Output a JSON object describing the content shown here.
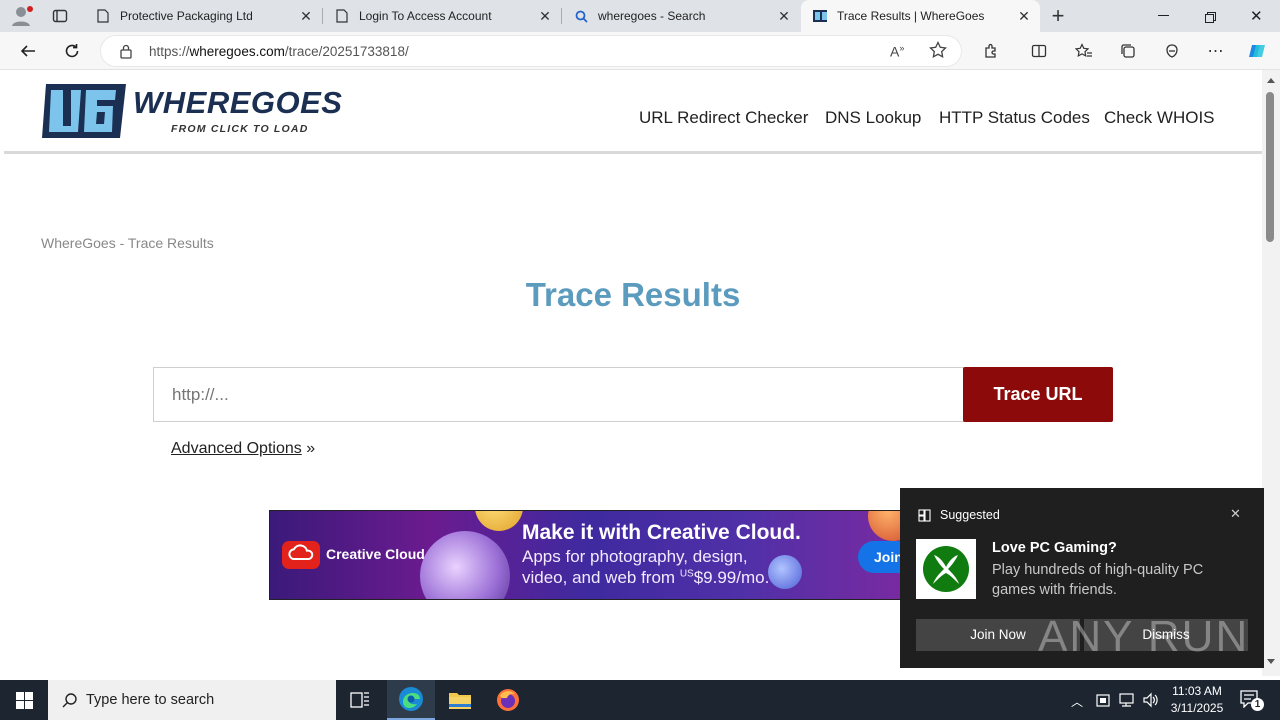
{
  "browser": {
    "tabs": [
      {
        "title": "Protective Packaging Ltd",
        "icon": "page-icon"
      },
      {
        "title": "Login To Access Account",
        "icon": "page-icon"
      },
      {
        "title": "wheregoes - Search",
        "icon": "search-icon"
      },
      {
        "title": "Trace Results | WhereGoes",
        "icon": "wheregoes-favicon",
        "active": true
      }
    ],
    "url_prefix": "https://",
    "url_domain": "wheregoes.com",
    "url_path": "/trace/20251733818/"
  },
  "site": {
    "logo_mark": "WG",
    "logo_name": "WHEREGOES",
    "logo_tagline": "FROM CLICK TO LOAD",
    "nav": [
      "URL Redirect Checker",
      "DNS Lookup",
      "HTTP Status Codes",
      "Check WHOIS"
    ]
  },
  "main": {
    "breadcrumb": "WhereGoes - Trace Results",
    "title": "Trace Results",
    "input_placeholder": "http://...",
    "trace_button": "Trace URL",
    "advanced_link": "Advanced Options",
    "advanced_suffix": "»"
  },
  "ad": {
    "brand": "Creative Cloud",
    "headline": "Make it with Creative Cloud.",
    "body_line1": "Apps for photography, design,",
    "body_line2_prefix": "video, and web from ",
    "price_currency": "US",
    "price": "$9.99/mo.",
    "cta": "Join"
  },
  "notification": {
    "header": "Suggested",
    "title": "Love PC Gaming?",
    "body": "Play hundreds of high-quality PC games with friends.",
    "primary_button": "Join Now",
    "secondary_button": "Dismiss",
    "watermark": "ANY RUN"
  },
  "taskbar": {
    "search_placeholder": "Type here to search",
    "time": "11:03 AM",
    "date": "3/11/2025",
    "notification_count": "1"
  },
  "colors": {
    "title_blue": "#5b9bbd",
    "button_red": "#8c0a0a",
    "logo_navy": "#1b2f52",
    "logo_light_blue": "#7cc4ec"
  }
}
